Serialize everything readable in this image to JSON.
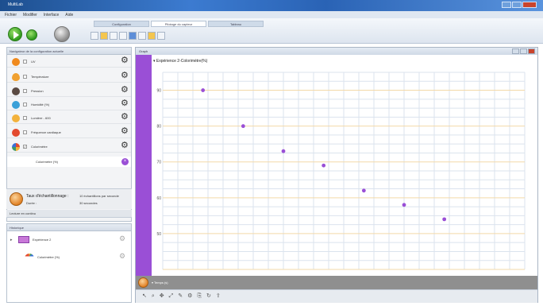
{
  "titlebar": {
    "title": "MultiLab",
    "close_color": "#c9442c"
  },
  "menubar": {
    "items": [
      "Fichier",
      "Modifier",
      "Interface",
      "Aide"
    ]
  },
  "toolbar": {
    "tabs": [
      {
        "label": "Configuration"
      },
      {
        "label": "Pilotage du capteur",
        "active": true
      },
      {
        "label": "Tableau"
      }
    ],
    "icons": [
      "play-icon",
      "record-icon",
      "stop-icon",
      "settings-icon"
    ]
  },
  "left_panel": {
    "header": "Navigateur de la configuration actuelle",
    "sensors": [
      {
        "label": "UV",
        "icon": "uv-sensor-icon",
        "color": "#f08a1e",
        "checked": false
      },
      {
        "label": "Température",
        "icon": "temperature-icon",
        "color": "#f0a030",
        "checked": false
      },
      {
        "label": "Pression",
        "icon": "pressure-icon",
        "color": "#5a4a42",
        "checked": false
      },
      {
        "label": "Humidité (%)",
        "icon": "humidity-icon",
        "color": "#3aa0d8",
        "checked": false
      },
      {
        "label": "Lumière - 600",
        "icon": "light-icon",
        "color": "#f3b23c",
        "checked": false
      },
      {
        "label": "Fréquence cardiaque",
        "icon": "heart-icon",
        "color": "#e34a2f",
        "checked": false
      },
      {
        "label": "Colorimètre",
        "icon": "colorimeter-icon",
        "color": "#3d9a6a",
        "checked": true
      }
    ],
    "selected_channel": "Colorimètre (%)"
  },
  "sampling": {
    "title": "Taux d'échantillonnage :",
    "duration_label": "Durée :",
    "rate_value": "10 échantillons par seconde",
    "duration_value": "30 secondes"
  },
  "acq_mode": "Lecture en continu",
  "history": {
    "header": "Historique",
    "experiment": "Expérience 2",
    "channel": "Colorimètre (%)"
  },
  "graph": {
    "header": "Graph",
    "experiment_title": "Expérience 2-Colorimètre(%)",
    "bottom_axis_label": "Temps (s)",
    "series_color": "#9a4fd6"
  },
  "chart_data": {
    "type": "scatter",
    "title": "Expérience 2-Colorimètre(%)",
    "xlabel": "Temps (s)",
    "ylabel": "",
    "y_tick_labels": [
      "90",
      "80",
      "70",
      "60",
      "50"
    ],
    "series": [
      {
        "x": [
          1,
          2,
          3,
          4,
          5,
          6,
          7
        ],
        "y": [
          90,
          80,
          73,
          69,
          62,
          58,
          54
        ]
      }
    ],
    "xlim": [
      0,
      9
    ],
    "ylim": [
      40,
      95
    ],
    "grid": true
  }
}
